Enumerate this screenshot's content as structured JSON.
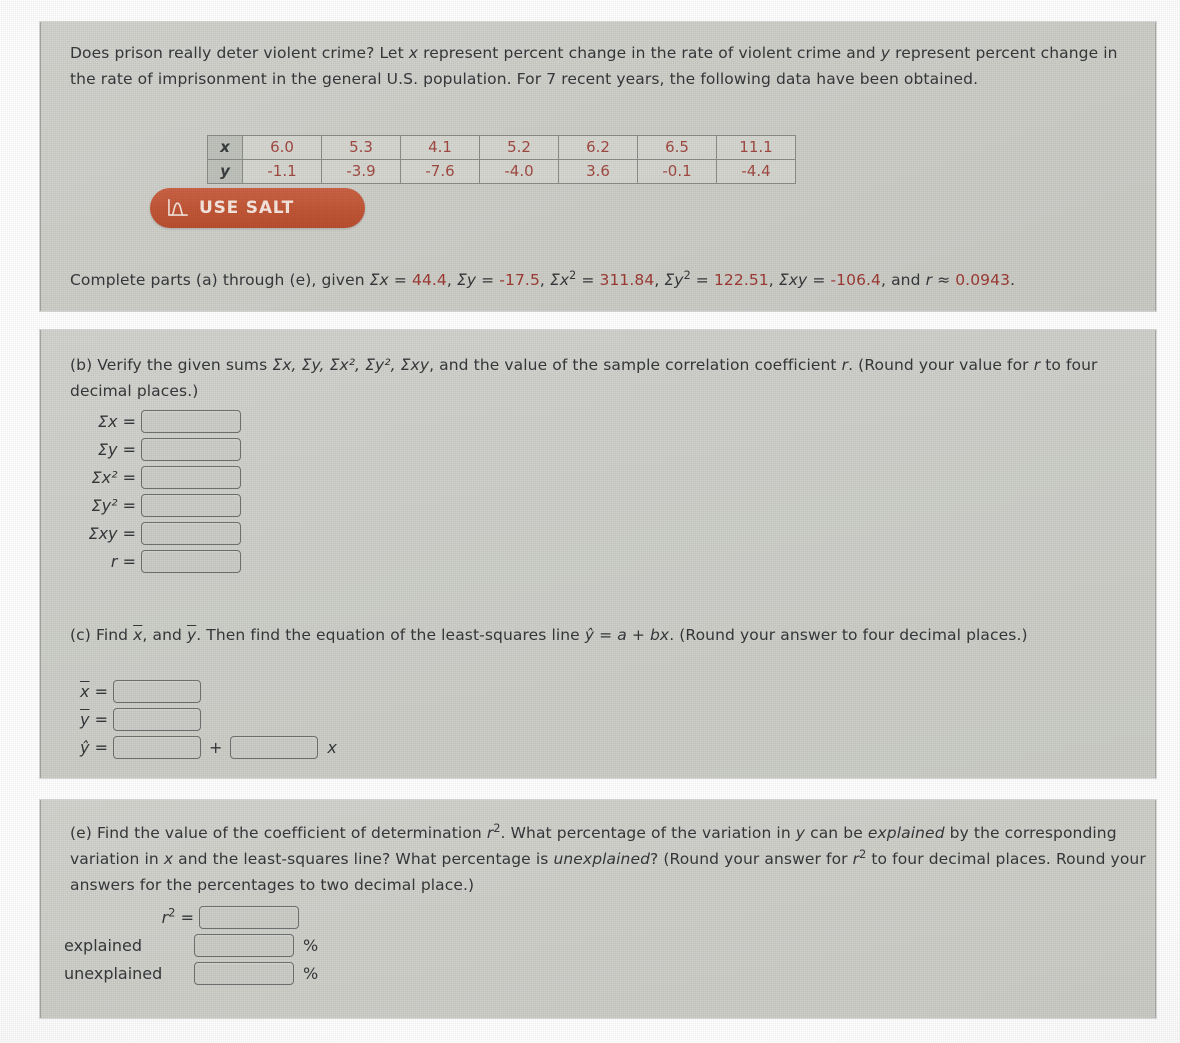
{
  "problem": {
    "intro_part1": "Does prison really deter violent crime? Let ",
    "intro_x": "x",
    "intro_part2": " represent percent change in the rate of violent crime and ",
    "intro_y": "y",
    "intro_part3": " represent percent change in the rate of imprisonment in the general U.S. population. For 7 recent years, the following data have been obtained."
  },
  "data_table": {
    "row_x_label": "x",
    "row_y_label": "y",
    "x_values": [
      "6.0",
      "5.3",
      "4.1",
      "5.2",
      "6.2",
      "6.5",
      "11.1"
    ],
    "y_values": [
      "-1.1",
      "-3.9",
      "-7.6",
      "-4.0",
      "3.6",
      "-0.1",
      "-4.4"
    ]
  },
  "salt_button": {
    "label": "USE SALT",
    "icon": "normal-distribution-icon",
    "color": "#c25736"
  },
  "sums_line": {
    "prefix": "Complete parts (a) through (e), given ",
    "sum_x_label": "Σx",
    "sum_x_value": "44.4",
    "sum_y_label": "Σy",
    "sum_y_value": "-17.5",
    "sum_x2_label": "Σx",
    "sum_x2_value": "311.84",
    "sum_y2_label": "Σy",
    "sum_y2_value": "122.51",
    "sum_xy_label": "Σxy",
    "sum_xy_value": "-106.4",
    "r_label": "r",
    "r_approx": "≈",
    "r_value": "0.0943",
    "suffix_and": ", and ",
    "period": ".",
    "value_color": "#9c3a33"
  },
  "part_b": {
    "text_1": "(b) Verify the given sums ",
    "sums_inline": "Σx, Σy, Σx², Σy², Σxy",
    "text_2": ", and the value of the sample correlation coefficient ",
    "r": "r",
    "text_3": ". (Round your value for ",
    "text_4": " to four decimal places.)",
    "fields": [
      {
        "label": "Σx =",
        "value": "",
        "name": "sum-x-input"
      },
      {
        "label": "Σy =",
        "value": "",
        "name": "sum-y-input"
      },
      {
        "label": "Σx² =",
        "value": "",
        "name": "sum-x-squared-input"
      },
      {
        "label": "Σy² =",
        "value": "",
        "name": "sum-y-squared-input"
      },
      {
        "label": "Σxy =",
        "value": "",
        "name": "sum-xy-input"
      },
      {
        "label": "r =",
        "value": "",
        "name": "r-input"
      }
    ]
  },
  "part_c": {
    "text_1": "(c) Find ",
    "xbar": "x",
    "text_2": ", and ",
    "ybar": "y",
    "text_3": ". Then find the equation of the least-squares line ",
    "equation": "ŷ = a + bx",
    "text_4": ". (Round your answer to four decimal places.)",
    "label_xbar": "=",
    "label_ybar": "=",
    "label_yhat": "ŷ =",
    "plus": "+",
    "x_tail": "x",
    "values": {
      "xbar": "",
      "ybar": "",
      "intercept": "",
      "slope": ""
    }
  },
  "part_e": {
    "text_1": "(e) Find the value of the coefficient of determination ",
    "r2": "r",
    "text_2": ". What percentage of the variation in ",
    "var_y": "y",
    "text_3": " can be ",
    "explained_em": "explained",
    "text_4": " by the corresponding variation in ",
    "var_x": "x",
    "text_5": " and the least-squares line? What percentage is ",
    "unexplained_em": "unexplained",
    "text_6": "? (Round your answer for ",
    "text_7": " to four decimal places. Round your answers for the percentages to two decimal place.)",
    "r2_label": "=",
    "explained_label": "explained",
    "unexplained_label": "unexplained",
    "percent_sign": "%",
    "values": {
      "r2": "",
      "explained": "",
      "unexplained": ""
    }
  }
}
